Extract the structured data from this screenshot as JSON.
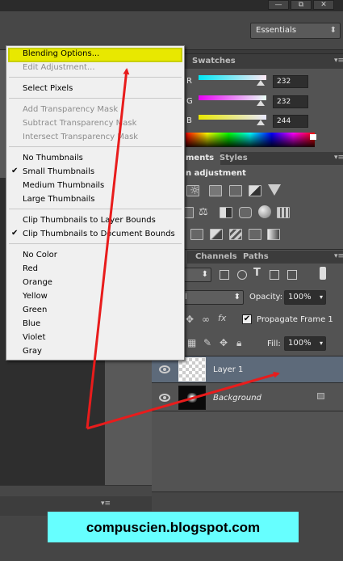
{
  "window": {
    "min_label": "—",
    "restore_label": "⧉",
    "close_label": "✕"
  },
  "workspace": {
    "label": "Essentials"
  },
  "color_panel": {
    "tab_swatches": "Swatches",
    "r_label": "R",
    "r_value": "232",
    "g_label": "G",
    "g_value": "232",
    "b_label": "B",
    "b_value": "244"
  },
  "adjustments": {
    "tab": "ments",
    "tab_styles": "Styles",
    "title": "n adjustment"
  },
  "layers": {
    "tab_channels": "Channels",
    "tab_paths": "Paths",
    "kind_value": "d",
    "blend_value": "al",
    "opacity_label": "Opacity:",
    "opacity_value": "100%",
    "propagate_label": "Propagate Frame 1",
    "fill_label": "Fill:",
    "fill_value": "100%",
    "rows": [
      {
        "name": "Layer 1"
      },
      {
        "name": "Background"
      }
    ]
  },
  "context_menu": {
    "items": [
      {
        "label": "Blending Options...",
        "disabled": false,
        "checked": false
      },
      {
        "label": "Edit Adjustment...",
        "disabled": true,
        "checked": false
      },
      {
        "label": "Select Pixels",
        "disabled": false,
        "checked": false
      },
      {
        "label": "Add Transparency Mask",
        "disabled": true,
        "checked": false
      },
      {
        "label": "Subtract Transparency Mask",
        "disabled": true,
        "checked": false
      },
      {
        "label": "Intersect Transparency Mask",
        "disabled": true,
        "checked": false
      },
      {
        "label": "No Thumbnails",
        "disabled": false,
        "checked": false
      },
      {
        "label": "Small Thumbnails",
        "disabled": false,
        "checked": true
      },
      {
        "label": "Medium Thumbnails",
        "disabled": false,
        "checked": false
      },
      {
        "label": "Large Thumbnails",
        "disabled": false,
        "checked": false
      },
      {
        "label": "Clip Thumbnails to Layer Bounds",
        "disabled": false,
        "checked": false
      },
      {
        "label": "Clip Thumbnails to Document Bounds",
        "disabled": false,
        "checked": true
      },
      {
        "label": "No Color",
        "disabled": false,
        "checked": false
      },
      {
        "label": "Red",
        "disabled": false,
        "checked": false
      },
      {
        "label": "Orange",
        "disabled": false,
        "checked": false
      },
      {
        "label": "Yellow",
        "disabled": false,
        "checked": false
      },
      {
        "label": "Green",
        "disabled": false,
        "checked": false
      },
      {
        "label": "Blue",
        "disabled": false,
        "checked": false
      },
      {
        "label": "Violet",
        "disabled": false,
        "checked": false
      },
      {
        "label": "Gray",
        "disabled": false,
        "checked": false
      }
    ],
    "check_glyph": "✔"
  },
  "watermark": {
    "text": "compuscien.blogspot.com"
  },
  "colors": {
    "highlight": "#e8e800",
    "arrow": "#e81c1c",
    "watermark_bg": "#66ffff"
  }
}
